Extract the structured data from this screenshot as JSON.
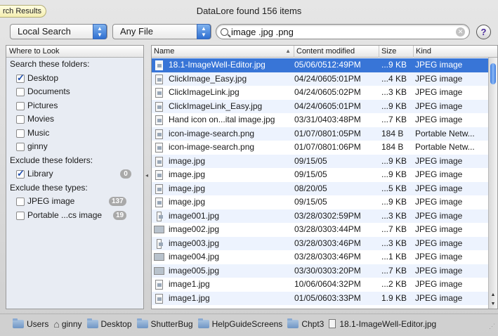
{
  "window": {
    "title": "DataLore found 156 items",
    "tab_badge": "rch Results"
  },
  "toolbar": {
    "scope_popup": "Local Search",
    "filetype_popup": "Any File",
    "search_value": "image .jpg .png",
    "help_label": "?"
  },
  "sidebar": {
    "header": "Where to Look",
    "search_folders_label": "Search these folders:",
    "search_folders": [
      {
        "label": "Desktop",
        "checked": true
      },
      {
        "label": "Documents",
        "checked": false
      },
      {
        "label": "Pictures",
        "checked": false
      },
      {
        "label": "Movies",
        "checked": false
      },
      {
        "label": "Music",
        "checked": false
      },
      {
        "label": "ginny",
        "checked": false
      }
    ],
    "exclude_folders_label": "Exclude these folders:",
    "exclude_folders": [
      {
        "label": "Library",
        "checked": true,
        "count": "0"
      }
    ],
    "exclude_types_label": "Exclude these types:",
    "exclude_types": [
      {
        "label": "JPEG image",
        "checked": false,
        "count": "137"
      },
      {
        "label": "Portable ...cs image",
        "checked": false,
        "count": "19"
      }
    ]
  },
  "results": {
    "columns": {
      "name": "Name",
      "modified": "Content modified",
      "size": "Size",
      "kind": "Kind"
    },
    "rows": [
      {
        "name": "18.1-ImageWell-Editor.jpg",
        "modified": "05/06/0512:49PM",
        "size": "...9 KB",
        "kind": "JPEG image",
        "selected": true
      },
      {
        "name": "ClickImage_Easy.jpg",
        "modified": "04/24/0605:01PM",
        "size": "...4 KB",
        "kind": "JPEG image"
      },
      {
        "name": "ClickImageLink.jpg",
        "modified": "04/24/0605:02PM",
        "size": "...3 KB",
        "kind": "JPEG image"
      },
      {
        "name": "ClickImageLink_Easy.jpg",
        "modified": "04/24/0605:01PM",
        "size": "...9 KB",
        "kind": "JPEG image"
      },
      {
        "name": "Hand icon on...ital image.jpg",
        "modified": "03/31/0403:48PM",
        "size": "...7 KB",
        "kind": "JPEG image"
      },
      {
        "name": "icon-image-search.png",
        "modified": "01/07/0801:05PM",
        "size": "184  B",
        "kind": "Portable Netw..."
      },
      {
        "name": "icon-image-search.png",
        "modified": "01/07/0801:06PM",
        "size": "184  B",
        "kind": "Portable Netw..."
      },
      {
        "name": "image.jpg",
        "modified": "09/15/05",
        "size": "...9 KB",
        "kind": "JPEG image"
      },
      {
        "name": "image.jpg",
        "modified": "09/15/05",
        "size": "...9 KB",
        "kind": "JPEG image"
      },
      {
        "name": "image.jpg",
        "modified": "08/20/05",
        "size": "...5 KB",
        "kind": "JPEG image"
      },
      {
        "name": "image.jpg",
        "modified": "09/15/05",
        "size": "...9 KB",
        "kind": "JPEG image"
      },
      {
        "name": "image001.jpg",
        "modified": "03/28/0302:59PM",
        "size": "...3 KB",
        "kind": "JPEG image"
      },
      {
        "name": "image002.jpg",
        "modified": "03/28/0303:44PM",
        "size": "...7 KB",
        "kind": "JPEG image"
      },
      {
        "name": "image003.jpg",
        "modified": "03/28/0303:46PM",
        "size": "...3 KB",
        "kind": "JPEG image"
      },
      {
        "name": "image004.jpg",
        "modified": "03/28/0303:46PM",
        "size": "...1 KB",
        "kind": "JPEG image"
      },
      {
        "name": "image005.jpg",
        "modified": "03/30/0303:20PM",
        "size": "...7 KB",
        "kind": "JPEG image"
      },
      {
        "name": "image1.jpg",
        "modified": "10/06/0604:32PM",
        "size": "...2 KB",
        "kind": "JPEG image"
      },
      {
        "name": "image1.jpg",
        "modified": "01/05/0603:33PM",
        "size": "1.9 KB",
        "kind": "JPEG image"
      }
    ]
  },
  "pathbar": {
    "items": [
      "Users",
      "ginny",
      "Desktop",
      "ShutterBug",
      "HelpGuideScreens",
      "Chpt3",
      "18.1-ImageWell-Editor.jpg"
    ]
  },
  "colors": {
    "selection": "#3875d7",
    "alt_row": "#edf3fe",
    "sidebar_bg": "#e8ecf3"
  }
}
